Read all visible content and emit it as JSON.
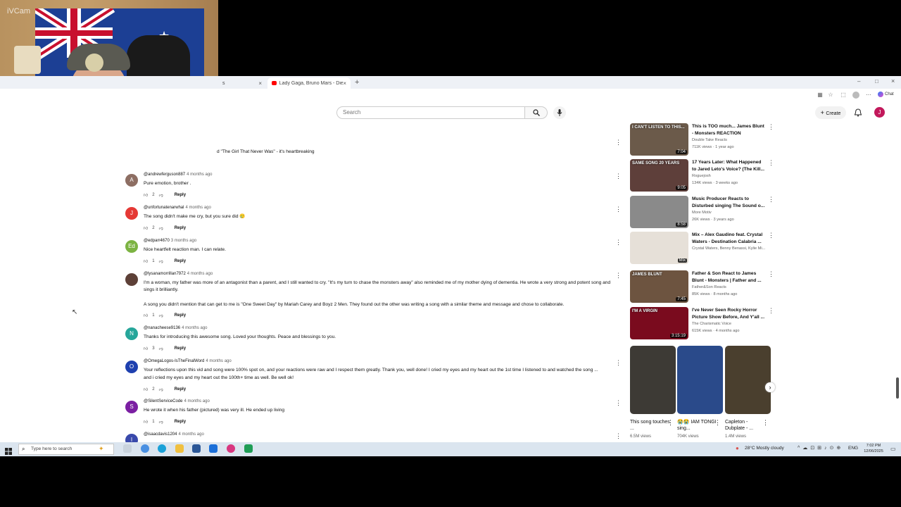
{
  "webcam": {
    "watermark": "iVCam"
  },
  "browser": {
    "tabs": [
      {
        "label": "s",
        "active": false
      },
      {
        "label": "Lady Gaga, Bruno Mars - Die With",
        "active": true
      }
    ],
    "new_tab": "+",
    "window_controls": [
      "–",
      "□",
      "×"
    ],
    "toolbar_right": {
      "chat_label": "Chat"
    }
  },
  "youtube": {
    "search": {
      "placeholder": "Search"
    },
    "create_label": "Create",
    "user_initial": "J"
  },
  "comments": [
    {
      "author": "",
      "ago": "",
      "text": "d \"The Girl That Never Was\" - it's heartbreaking",
      "likes": "",
      "avatar_letter": "",
      "avatar_color": ""
    },
    {
      "author": "@andrewferguson887",
      "ago": "4 months ago",
      "text": "Pure emotion, brother .",
      "likes": "2",
      "avatar_letter": "A",
      "avatar_color": "#8d6e63"
    },
    {
      "author": "@unfortunatenarwhal",
      "ago": "4 months ago",
      "text": "The song didn't make me cry, but you sure did 🥲",
      "likes": "2",
      "avatar_letter": "J",
      "avatar_color": "#e53935"
    },
    {
      "author": "@edparr4670",
      "ago": "3 months ago",
      "text": "Nice heartfelt reaction man. I can relate.",
      "likes": "1",
      "avatar_letter": "Ed",
      "avatar_color": "#7cb342"
    },
    {
      "author": "@lysanamorrillan7972",
      "ago": "4 months ago",
      "text": "I'm a woman, my father was more of an antagonist than a parent, and I still wanted to cry. \"It's my turn to chase the monsters away\" also reminded me of my mother dying of dementia. He wrote a very strong and potent song and sings it brilliantly.",
      "text2": "A song you didn't mention that can get to me is \"One Sweet Day\" by Mariah Carey and Boyz 2 Men. They found out the other was writing a song with a similar theme and message and chose to collaborate.",
      "likes": "1",
      "avatar_letter": "",
      "avatar_color": "#5d4037"
    },
    {
      "author": "@nanacheese9136",
      "ago": "4 months ago",
      "text": "Thanks for introducing this awesome song. Loved your thoughts. Peace and blessings to you.",
      "likes": "3",
      "avatar_letter": "N",
      "avatar_color": "#26a69a"
    },
    {
      "author": "@OmegaLogos-IsTheFinalWord",
      "ago": "4 months ago",
      "text": "Your reflections upon this vid and song were 100% spot on, and your reactions were raw and I respect them greatly. Thank you, well done! I cried my eyes and my heart out the 1st time I listened to and watched the song ...",
      "text2": "and i cried my eyes and my heart out the 100th+ time as well. Be well ok!",
      "likes": "2",
      "avatar_letter": "O",
      "avatar_color": "#1e40af"
    },
    {
      "author": "@SilentServiceCode",
      "ago": "4 months ago",
      "text": "He wrote it when his father (pictured) was very ill. He ended up living",
      "likes": "1",
      "avatar_letter": "S",
      "avatar_color": "#7b1fa2"
    },
    {
      "author": "@isaacdavis1204",
      "ago": "4 months ago",
      "text": "",
      "likes": "",
      "avatar_letter": "I",
      "avatar_color": "#3949ab"
    }
  ],
  "reply_label": "Reply",
  "sidebar": [
    {
      "title": "This is TOO much... James Blunt - Monsters REACTION",
      "channel": "Double Take Reacts",
      "meta": "711K views · 1 year ago",
      "duration": "7:04",
      "thumb_color": "#6b5a4a",
      "overlay": "I CAN'T LISTEN TO THIS..."
    },
    {
      "title": "17 Years Later: What Happened to Jared Leto's Voice? (The Kill...",
      "channel": "Roguejosh",
      "meta": "134K views · 3 weeks ago",
      "duration": "9:05",
      "thumb_color": "#5e3f3a",
      "overlay": "SAME SONG 20 YEARS"
    },
    {
      "title": "Music Producer Reacts to Disturbed singing The Sound o...",
      "channel": "More Motiv",
      "meta": "26K views · 3 years ago",
      "duration": "8:58",
      "thumb_color": "#8a8a8a",
      "overlay": ""
    },
    {
      "title": "Mix – Alex Gaudino feat. Crystal Waters - Destination Calabria ...",
      "channel": "Crystal Waters, Benny Benassi, Kylie Mi...",
      "meta": "",
      "duration": "Mix",
      "thumb_color": "#e6e0d8",
      "overlay": ""
    },
    {
      "title": "Father & Son React to James Blunt - Monsters | Father and ...",
      "channel": "Father&Son Reacts",
      "meta": "85K views · 8 months ago",
      "duration": "7:45",
      "thumb_color": "#6d5440",
      "overlay": "JAMES BLUNT"
    },
    {
      "title": "I've Never Seen Rocky Horror Picture Show Before, And Y'all ...",
      "channel": "The Charismatic Voice",
      "meta": "615K views · 4 months ago",
      "duration": "3:15:19",
      "thumb_color": "#7a0b1e",
      "overlay": "I'M A VIRGIN"
    }
  ],
  "shorts": [
    {
      "title": "This song touches ...",
      "views": "6.5M views",
      "color": "#3d3a35"
    },
    {
      "title": "😭😭 IAM TONGI sing...",
      "views": "704K views",
      "color": "#2a4a8a"
    },
    {
      "title": "Capleton - Dubplate - ...",
      "views": "1.4M views",
      "color": "#4a3f2e"
    }
  ],
  "taskbar": {
    "search_placeholder": "Type here to search",
    "weather": "28°C  Mostly cloudy",
    "lang": "ENG",
    "time": "7:02 PM",
    "date": "12/06/2025"
  }
}
